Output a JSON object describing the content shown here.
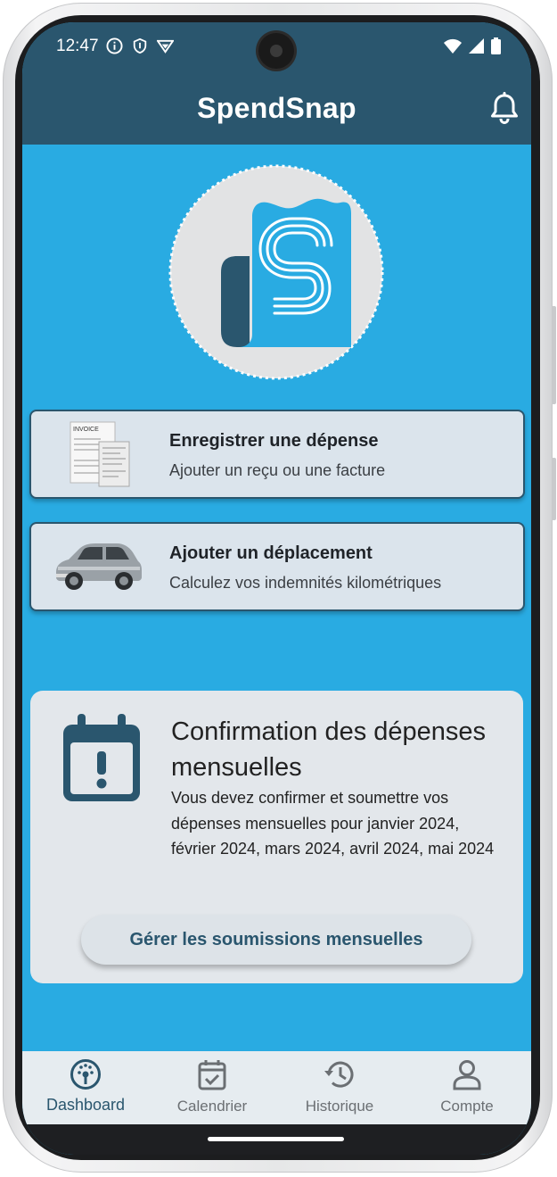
{
  "status_bar": {
    "time": "12:47",
    "left_icons": [
      "info-circle-icon",
      "shield-icon",
      "vpn-icon"
    ],
    "right_icons": [
      "wifi-icon",
      "signal-icon",
      "battery-icon"
    ]
  },
  "header": {
    "title": "SpendSnap",
    "bell_icon": "bell-icon"
  },
  "actions": [
    {
      "title": "Enregistrer une dépense",
      "subtitle": "Ajouter un reçu ou une facture",
      "image": "invoice-image",
      "invoice_label": "INVOICE"
    },
    {
      "title": "Ajouter un déplacement",
      "subtitle": "Calculez vos indemnités kilométriques",
      "image": "car-image"
    }
  ],
  "confirmation": {
    "icon": "calendar-alert-icon",
    "title": "Confirmation des dépenses mensuelles",
    "text": "Vous devez confirmer et soumettre vos dépenses mensuelles pour janvier 2024, février 2024, mars 2024, avril 2024, mai 2024",
    "button_label": "Gérer les soumissions mensuelles"
  },
  "bottom_nav": [
    {
      "label": "Dashboard",
      "icon": "dashboard-gauge-icon",
      "active": true
    },
    {
      "label": "Calendrier",
      "icon": "calendar-check-icon",
      "active": false
    },
    {
      "label": "Historique",
      "icon": "history-icon",
      "active": false
    },
    {
      "label": "Compte",
      "icon": "account-icon",
      "active": false
    }
  ],
  "colors": {
    "primary_dark": "#2a566e",
    "background_blue": "#29abe2",
    "card_bg": "#dbe4ec",
    "nav_bg": "#e6ecf0"
  }
}
